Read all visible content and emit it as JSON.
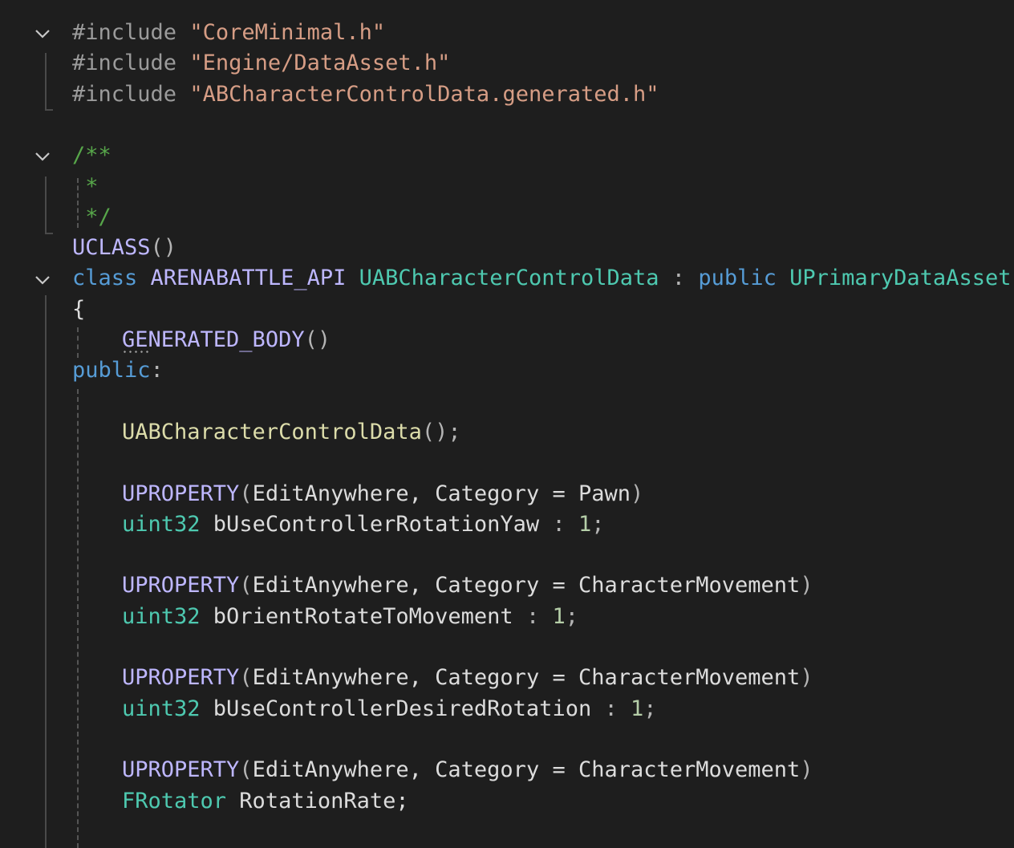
{
  "code_editor": {
    "lines": [
      {
        "tokens": [
          {
            "t": "#include ",
            "c": "pp"
          },
          {
            "t": "\"CoreMinimal.h\"",
            "c": "str"
          }
        ]
      },
      {
        "tokens": [
          {
            "t": "#include ",
            "c": "pp"
          },
          {
            "t": "\"Engine/DataAsset.h\"",
            "c": "str"
          }
        ]
      },
      {
        "tokens": [
          {
            "t": "#include ",
            "c": "pp"
          },
          {
            "t": "\"ABCharacterControlData.generated.h\"",
            "c": "str"
          }
        ]
      },
      {
        "tokens": []
      },
      {
        "tokens": [
          {
            "t": "/**",
            "c": "cmt"
          }
        ]
      },
      {
        "tokens": [
          {
            "t": " *",
            "c": "cmt"
          }
        ]
      },
      {
        "tokens": [
          {
            "t": " */",
            "c": "cmt"
          }
        ]
      },
      {
        "tokens": [
          {
            "t": "UCLASS",
            "c": "macro"
          },
          {
            "t": "()",
            "c": "punct"
          }
        ]
      },
      {
        "tokens": [
          {
            "t": "class",
            "c": "kw"
          },
          {
            "t": " ",
            "c": "id"
          },
          {
            "t": "ARENABATTLE_API",
            "c": "macro"
          },
          {
            "t": " ",
            "c": "id"
          },
          {
            "t": "UABCharacterControlData",
            "c": "type"
          },
          {
            "t": " : ",
            "c": "punct"
          },
          {
            "t": "public",
            "c": "kw"
          },
          {
            "t": " ",
            "c": "id"
          },
          {
            "t": "UPrimaryDataAsset",
            "c": "type"
          }
        ]
      },
      {
        "tokens": [
          {
            "t": "{",
            "c": "id"
          }
        ]
      },
      {
        "tokens": [
          {
            "t": "GE",
            "c": "macro",
            "s": true
          },
          {
            "t": "NERATED_BODY",
            "c": "macro"
          },
          {
            "t": "()",
            "c": "punct"
          }
        ]
      },
      {
        "tokens": [
          {
            "t": "public",
            "c": "kw"
          },
          {
            "t": ":",
            "c": "punct"
          }
        ]
      },
      {
        "tokens": []
      },
      {
        "tokens": [
          {
            "t": "UABCharacterControlData",
            "c": "fn"
          },
          {
            "t": "();",
            "c": "punct"
          }
        ]
      },
      {
        "tokens": []
      },
      {
        "tokens": [
          {
            "t": "UPROPERTY",
            "c": "macro"
          },
          {
            "t": "(",
            "c": "punct"
          },
          {
            "t": "EditAnywhere, Category = Pawn",
            "c": "id"
          },
          {
            "t": ")",
            "c": "punct"
          }
        ]
      },
      {
        "tokens": [
          {
            "t": "uint32",
            "c": "type"
          },
          {
            "t": " bUseControllerRotationYaw ",
            "c": "id"
          },
          {
            "t": ": ",
            "c": "punct"
          },
          {
            "t": "1",
            "c": "num"
          },
          {
            "t": ";",
            "c": "punct"
          }
        ]
      },
      {
        "tokens": []
      },
      {
        "tokens": [
          {
            "t": "UPROPERTY",
            "c": "macro"
          },
          {
            "t": "(",
            "c": "punct"
          },
          {
            "t": "EditAnywhere, Category = CharacterMovement",
            "c": "id"
          },
          {
            "t": ")",
            "c": "punct"
          }
        ]
      },
      {
        "tokens": [
          {
            "t": "uint32",
            "c": "type"
          },
          {
            "t": " bOrientRotateToMovement ",
            "c": "id"
          },
          {
            "t": ": ",
            "c": "punct"
          },
          {
            "t": "1",
            "c": "num"
          },
          {
            "t": ";",
            "c": "punct"
          }
        ]
      },
      {
        "tokens": []
      },
      {
        "tokens": [
          {
            "t": "UPROPERTY",
            "c": "macro"
          },
          {
            "t": "(",
            "c": "punct"
          },
          {
            "t": "EditAnywhere, Category = CharacterMovement",
            "c": "id"
          },
          {
            "t": ")",
            "c": "punct"
          }
        ]
      },
      {
        "tokens": [
          {
            "t": "uint32",
            "c": "type"
          },
          {
            "t": " bUseControllerDesiredRotation ",
            "c": "id"
          },
          {
            "t": ": ",
            "c": "punct"
          },
          {
            "t": "1",
            "c": "num"
          },
          {
            "t": ";",
            "c": "punct"
          }
        ]
      },
      {
        "tokens": []
      },
      {
        "tokens": [
          {
            "t": "UPROPERTY",
            "c": "macro"
          },
          {
            "t": "(",
            "c": "punct"
          },
          {
            "t": "EditAnywhere, Category = CharacterMovement",
            "c": "id"
          },
          {
            "t": ")",
            "c": "punct"
          }
        ]
      },
      {
        "tokens": [
          {
            "t": "FRotator",
            "c": "type"
          },
          {
            "t": " RotationRate;",
            "c": "id"
          }
        ]
      },
      {
        "tokens": []
      }
    ],
    "fold_icons": [
      "chevron-down-icon",
      "chevron-down-icon",
      "chevron-down-icon"
    ],
    "colors": {
      "background": "#1e1e1e",
      "keyword": "#569cd6",
      "preprocessor": "#9b9b9b",
      "string": "#d69d85",
      "comment": "#57a64a",
      "macro": "#beb7ff",
      "type": "#4ec9b0",
      "function": "#dcdcaa",
      "number": "#b5cea8"
    }
  }
}
